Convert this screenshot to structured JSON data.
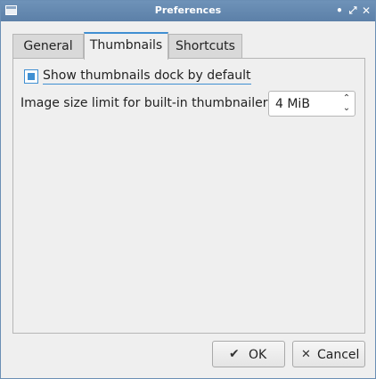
{
  "window": {
    "title": "Preferences",
    "controls": {
      "minimize": "•",
      "maximize": "⤢",
      "close": "✕"
    }
  },
  "tabs": [
    {
      "label": "General",
      "selected": false
    },
    {
      "label": "Thumbnails",
      "selected": true
    },
    {
      "label": "Shortcuts",
      "selected": false
    }
  ],
  "thumbnails": {
    "show_dock": {
      "label": "Show thumbnails dock by default",
      "checked": true
    },
    "size_limit": {
      "label": "Image size limit for built-in thumbnailer:",
      "value": "4 MiB"
    }
  },
  "buttons": {
    "ok": {
      "label": "OK",
      "icon": "✔"
    },
    "cancel": {
      "label": "Cancel",
      "icon": "✕"
    }
  },
  "colors": {
    "accent": "#3f8fd2",
    "titlebar": "#6587ad"
  }
}
